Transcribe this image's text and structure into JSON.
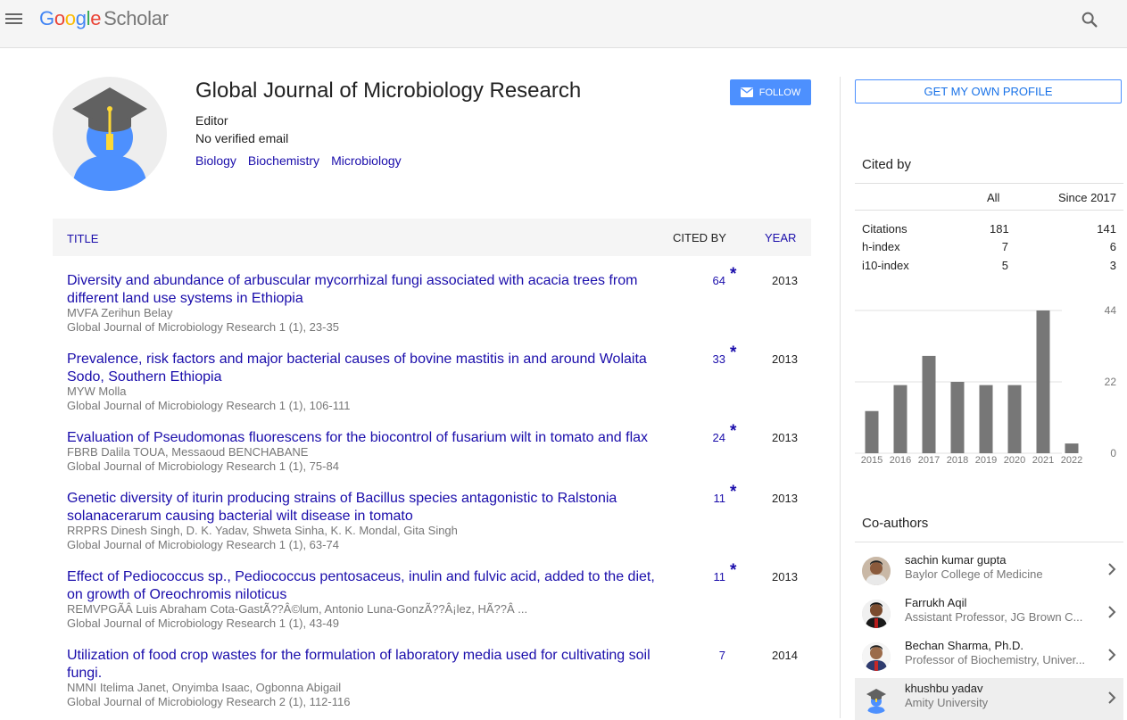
{
  "header": {
    "logo_google": "Google",
    "logo_scholar": "Scholar",
    "menu_icon": "hamburger-menu-icon",
    "search_icon": "search-icon"
  },
  "profile": {
    "name": "Global Journal of Microbiology Research",
    "role": "Editor",
    "email": "No verified email",
    "interests": [
      "Biology",
      "Biochemistry",
      "Microbiology"
    ],
    "follow_label": "FOLLOW"
  },
  "table": {
    "col_title": "TITLE",
    "col_cited": "CITED BY",
    "col_year": "YEAR",
    "rows": [
      {
        "title": "Diversity and abundance of arbuscular mycorrhizal fungi associated with acacia trees from different land use systems in Ethiopia",
        "authors": "MVFA Zerihun Belay",
        "venue": "Global Journal of Microbiology Research 1 (1), 23-35",
        "cited": "64",
        "star": "*",
        "year": "2013"
      },
      {
        "title": "Prevalence, risk factors and major bacterial causes of bovine mastitis in and around Wolaita Sodo, Southern Ethiopia",
        "authors": "MYW Molla",
        "venue": "Global Journal of Microbiology Research 1 (1), 106-111",
        "cited": "33",
        "star": "*",
        "year": "2013"
      },
      {
        "title": "Evaluation of Pseudomonas fluorescens for the biocontrol of fusarium wilt in tomato and flax",
        "authors": "FBRB Dalila TOUA, Messaoud BENCHABANE",
        "venue": "Global Journal of Microbiology Research 1 (1), 75-84",
        "cited": "24",
        "star": "*",
        "year": "2013"
      },
      {
        "title": "Genetic diversity of iturin producing strains of Bacillus species antagonistic to Ralstonia solanacerarum causing bacterial wilt disease in tomato",
        "authors": "RRPRS Dinesh Singh, D. K. Yadav, Shweta Sinha, K. K. Mondal, Gita Singh",
        "venue": "Global Journal of Microbiology Research 1 (1), 63-74",
        "cited": "11",
        "star": "*",
        "year": "2013"
      },
      {
        "title": "Effect of Pediococcus sp., Pediococcus pentosaceus, inulin and fulvic acid, added to the diet, on growth of Oreochromis niloticus",
        "authors": "REMVPGÃÂ Luis Abraham Cota-GastÃ??Â©lum, Antonio Luna-GonzÃ??Â¡lez, HÃ??Â ...",
        "venue": "Global Journal of Microbiology Research 1 (1), 43-49",
        "cited": "11",
        "star": "*",
        "year": "2013"
      },
      {
        "title": "Utilization of food crop wastes for the formulation of laboratory media used for cultivating soil fungi.",
        "authors": "NMNI Itelima Janet, Onyimba Isaac, Ogbonna Abigail",
        "venue": "Global Journal of Microbiology Research 2 (1), 112-116",
        "cited": "7",
        "star": "",
        "year": "2014"
      }
    ]
  },
  "sidebar": {
    "get_profile_label": "GET MY OWN PROFILE",
    "cited_by_heading": "Cited by",
    "col_all": "All",
    "col_since": "Since 2017",
    "stats": [
      {
        "label": "Citations",
        "all": "181",
        "since": "141"
      },
      {
        "label": "h-index",
        "all": "7",
        "since": "6"
      },
      {
        "label": "i10-index",
        "all": "5",
        "since": "3"
      }
    ],
    "coauthors_heading": "Co-authors",
    "coauthors": [
      {
        "name": "sachin kumar gupta",
        "inst": "Baylor College of Medicine"
      },
      {
        "name": "Farrukh Aqil",
        "inst": "Assistant Professor, JG Brown C..."
      },
      {
        "name": "Bechan Sharma, Ph.D.",
        "inst": "Professor of Biochemistry, Univer..."
      },
      {
        "name": "khushbu yadav",
        "inst": "Amity University"
      }
    ]
  },
  "chart_data": {
    "type": "bar",
    "categories": [
      "2015",
      "2016",
      "2017",
      "2018",
      "2019",
      "2020",
      "2021",
      "2022"
    ],
    "values": [
      13,
      21,
      30,
      22,
      21,
      21,
      44,
      3
    ],
    "ylim": [
      0,
      44
    ],
    "yticks": [
      "44",
      "22",
      "0"
    ],
    "grid": true,
    "bar_color": "#777777"
  }
}
